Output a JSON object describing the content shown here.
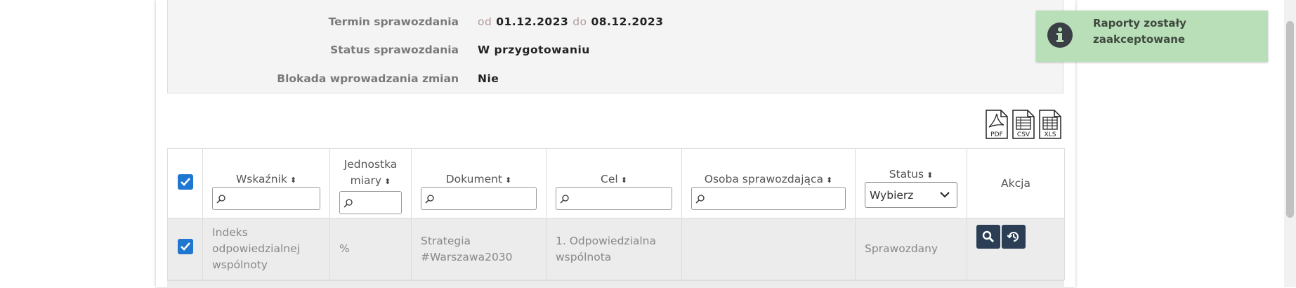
{
  "report_info": {
    "deadline_label": "Termin sprawozdania",
    "deadline_from_word": "od",
    "deadline_from": "01.12.2023",
    "deadline_to_word": "do",
    "deadline_to": "08.12.2023",
    "status_label": "Status sprawozdania",
    "status_value": "W przygotowaniu",
    "lock_label": "Blokada wprowadzania zmian",
    "lock_value": "Nie"
  },
  "exports": [
    {
      "label": "PDF",
      "icon": "pdf-file-icon"
    },
    {
      "label": "CSV",
      "icon": "csv-file-icon"
    },
    {
      "label": "XLS",
      "icon": "xls-file-icon"
    }
  ],
  "table": {
    "headers": {
      "indicator": "Wskaźnik",
      "unit": "Jednostka miary",
      "document": "Dokument",
      "goal": "Cel",
      "person": "Osoba sprawozdająca",
      "status": "Status",
      "action": "Akcja"
    },
    "status_filter_selected": "Wybierz",
    "rows": [
      {
        "checked": true,
        "indicator": "Indeks odpowiedzialnej wspólnoty",
        "unit": "%",
        "document": "Strategia #Warszawa2030",
        "goal": "1. Odpowiedzialna wspólnota",
        "person": "",
        "status": "Sprawozdany"
      }
    ]
  },
  "toast": {
    "message": "Raporty zostały zaakceptowane",
    "icon": "info-icon"
  },
  "colors": {
    "accent": "#1f77d0",
    "action_button": "#2b3e55",
    "toast_bg": "#b9dfb9"
  }
}
